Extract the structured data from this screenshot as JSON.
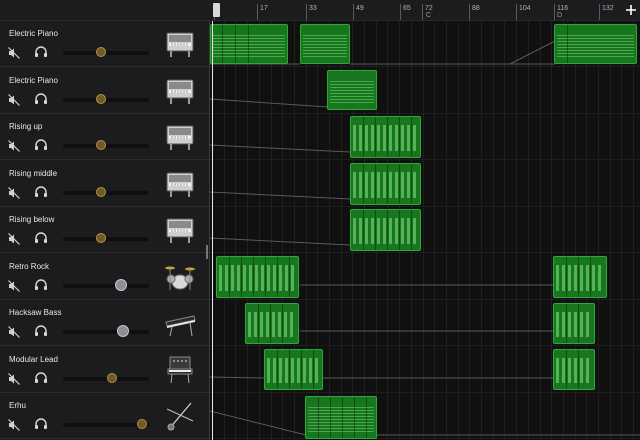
{
  "ruler": {
    "labels": [
      "1",
      "17",
      "33",
      "49",
      "65",
      "72",
      "88",
      "104",
      "116",
      "132"
    ],
    "sections": [
      "C",
      "D"
    ]
  },
  "tracks": [
    {
      "name": "Electric Piano",
      "instrument": "electric-piano-icon",
      "volume": 0.45,
      "knob": "gold"
    },
    {
      "name": "Electric Piano",
      "instrument": "electric-piano-icon",
      "volume": 0.45,
      "knob": "gold"
    },
    {
      "name": "Rising up",
      "instrument": "electric-piano-icon",
      "volume": 0.45,
      "knob": "gold"
    },
    {
      "name": "Rising middle",
      "instrument": "electric-piano-icon",
      "volume": 0.45,
      "knob": "gold"
    },
    {
      "name": "Rising below",
      "instrument": "electric-piano-icon",
      "volume": 0.45,
      "knob": "gold"
    },
    {
      "name": "Retro Rock",
      "instrument": "drum-kit-icon",
      "volume": 0.68,
      "knob": "grey"
    },
    {
      "name": "Hacksaw Bass",
      "instrument": "keyboard-synth-icon",
      "volume": 0.7,
      "knob": "grey"
    },
    {
      "name": "Modular Lead",
      "instrument": "modular-synth-icon",
      "volume": 0.58,
      "knob": "gold"
    },
    {
      "name": "Erhu",
      "instrument": "erhu-icon",
      "volume": 0.93,
      "knob": "gold"
    }
  ],
  "icons": {
    "mute": "speaker-muted-icon",
    "solo": "headphones-icon",
    "add": "plus-icon",
    "playhead": "playhead-icon"
  },
  "colors": {
    "region_fill": "#18761f",
    "region_border": "#2fa83a",
    "panel_bg": "#1c1c1e",
    "knob_gold": "#b8913a"
  }
}
